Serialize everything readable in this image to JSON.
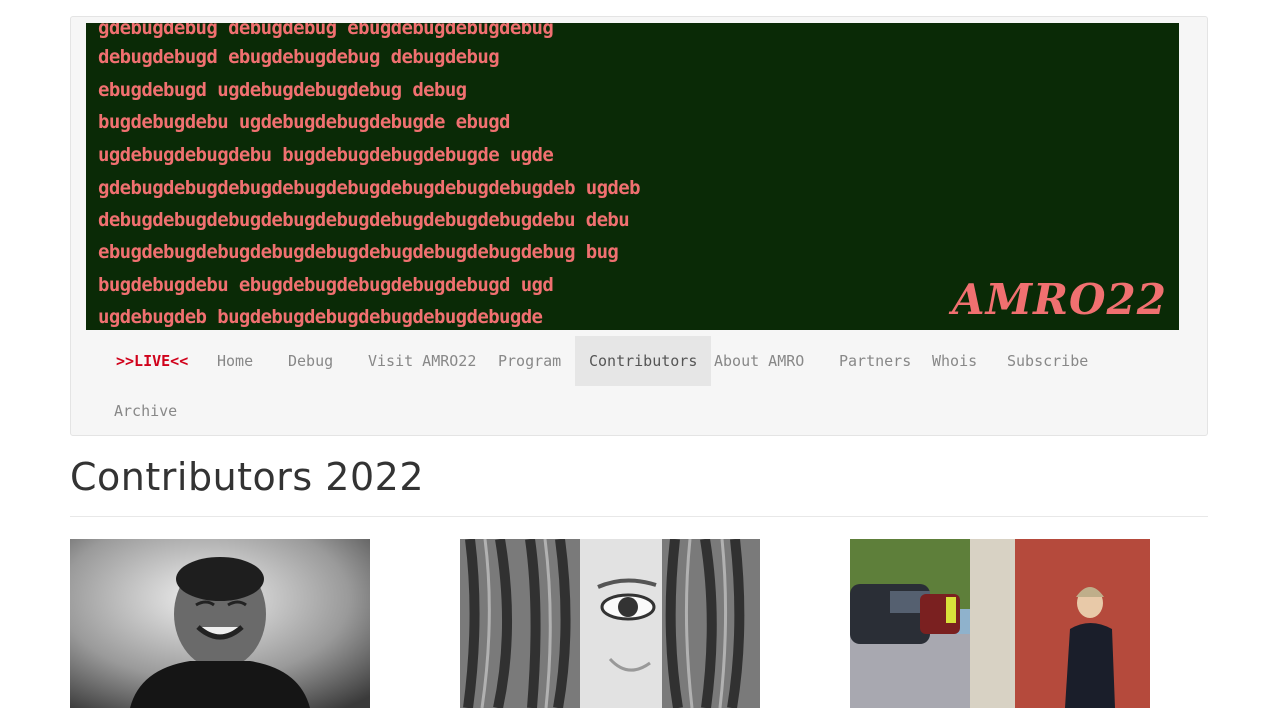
{
  "banner": {
    "lines": [
      "gdebugdebug debugdebug ebugdebugdebugdebug",
      "debugdebugd ebugdebugdebug debugdebug",
      "ebugdebugd ugdebugdebugdebug debug",
      "bugdebugdebu ugdebugdebugdebugde ebugd",
      "ugdebugdebugdebu bugdebugdebugdebugde ugde",
      "gdebugdebugdebugdebugdebugdebugdebugdebugdeb ugdeb",
      "debugdebugdebugdebugdebugdebugdebugdebugdebu debu",
      "ebugdebugdebugdebugdebugdebugdebugdebugdebug bug",
      "bugdebugdebu ebugdebugdebugdebugdebugd ugd",
      "ugdebugdeb bugdebugdebugdebugdebugdebugde"
    ],
    "logo": "AMRO22"
  },
  "nav": {
    "items": [
      {
        "label": ">>LIVE<<",
        "kind": "live"
      },
      {
        "label": "Home"
      },
      {
        "label": "Debug"
      },
      {
        "label": "Visit AMRO22"
      },
      {
        "label": "Program"
      },
      {
        "label": "Contributors",
        "kind": "active"
      },
      {
        "label": "About AMRO"
      },
      {
        "label": "Partners"
      },
      {
        "label": "Whois"
      },
      {
        "label": "Subscribe"
      },
      {
        "label": "Archive"
      }
    ]
  },
  "page": {
    "title": "Contributors 2022"
  },
  "colors": {
    "banner_bg": "#0a2a06",
    "banner_text": "#f07070",
    "live": "#d0021b",
    "nav_text": "#888888"
  }
}
